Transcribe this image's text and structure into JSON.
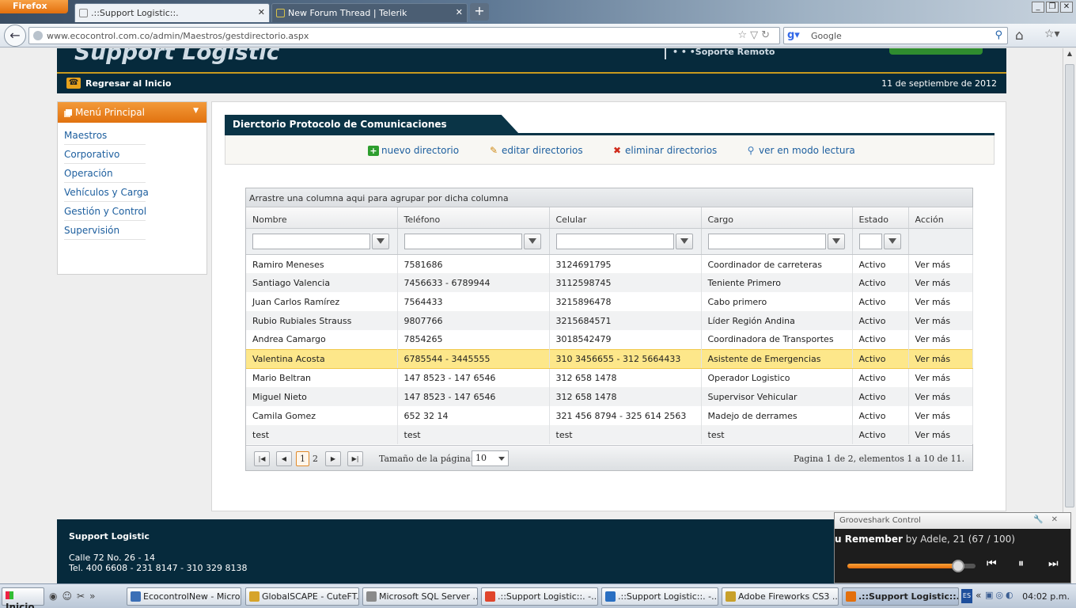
{
  "browser": {
    "menu_label": "Firefox",
    "tabs": [
      {
        "label": ".::Support Logistic::."
      },
      {
        "label": "New Forum Thread | Telerik"
      }
    ],
    "url": "www.ecocontrol.com.co/admin/Maestros/gestdirectorio.aspx",
    "search_placeholder": "Google"
  },
  "site": {
    "logo": "Support Logistic",
    "remote_label": "Soporte Remoto",
    "home_link": "Regresar al Inicio",
    "date": "11 de septiembre de 2012"
  },
  "menu": {
    "title": "Menú Principal",
    "items": [
      {
        "label": "Maestros"
      },
      {
        "label": "Corporativo"
      },
      {
        "label": "Operación"
      },
      {
        "label": "Vehículos y Carga"
      },
      {
        "label": "Gestión y Control"
      },
      {
        "label": "Supervisión"
      }
    ]
  },
  "section": {
    "title": "Dierctorio Protocolo de Comunicaciones",
    "toolbar": {
      "new": "nuevo directorio",
      "edit": "editar directorios",
      "delete": "eliminar directorios",
      "read": "ver en modo lectura"
    }
  },
  "grid": {
    "group_hint": "Arrastre una columna aqui para agrupar por dicha columna",
    "columns": [
      "Nombre",
      "Teléfono",
      "Celular",
      "Cargo",
      "Estado",
      "Acción"
    ],
    "rows": [
      {
        "nombre": "Ramiro Meneses",
        "telefono": "7581686",
        "celular": "3124691795",
        "cargo": "Coordinador de carreteras",
        "estado": "Activo",
        "accion": "Ver más"
      },
      {
        "nombre": "Santiago Valencia",
        "telefono": "7456633 - 6789944",
        "celular": "3112598745",
        "cargo": "Teniente Primero",
        "estado": "Activo",
        "accion": "Ver más"
      },
      {
        "nombre": "Juan Carlos Ramírez",
        "telefono": "7564433",
        "celular": "3215896478",
        "cargo": "Cabo primero",
        "estado": "Activo",
        "accion": "Ver más"
      },
      {
        "nombre": "Rubio Rubiales Strauss",
        "telefono": "9807766",
        "celular": "3215684571",
        "cargo": "Líder Región Andina",
        "estado": "Activo",
        "accion": "Ver más"
      },
      {
        "nombre": "Andrea Camargo",
        "telefono": "7854265",
        "celular": "3018542479",
        "cargo": "Coordinadora de Transportes",
        "estado": "Activo",
        "accion": "Ver más"
      },
      {
        "nombre": "Valentina Acosta",
        "telefono": "6785544 - 3445555",
        "celular": "310 3456655 - 312 5664433",
        "cargo": "Asistente de Emergencias",
        "estado": "Activo",
        "accion": "Ver más"
      },
      {
        "nombre": "Mario Beltran",
        "telefono": "147 8523 - 147 6546",
        "celular": "312 658 1478",
        "cargo": "Operador Logistico",
        "estado": "Activo",
        "accion": "Ver más"
      },
      {
        "nombre": "Miguel Nieto",
        "telefono": "147 8523 - 147 6546",
        "celular": "312 658 1478",
        "cargo": "Supervisor Vehicular",
        "estado": "Activo",
        "accion": "Ver más"
      },
      {
        "nombre": "Camila Gomez",
        "telefono": "652 32 14",
        "celular": "321 456 8794 - 325 614 2563",
        "cargo": "Madejo de derrames",
        "estado": "Activo",
        "accion": "Ver más"
      },
      {
        "nombre": "test",
        "telefono": "test",
        "celular": "test",
        "cargo": "test",
        "estado": "Activo",
        "accion": "Ver más"
      }
    ],
    "pager": {
      "page1": "1",
      "page2": "2",
      "size_label": "Tamaño de la página:",
      "size_value": "10",
      "info": "Pagina 1 de 2, elementos 1 a 10 de 11."
    }
  },
  "footer": {
    "company": "Support Logistic",
    "address": "Calle 72 No. 26 - 14",
    "phones": "Tel. 400 6608 - 231 8147 - 310 329 8138"
  },
  "grooveshark": {
    "title": "Grooveshark Control",
    "song": "u Remember",
    "artist": "by Adele, 21 (67 / 100)",
    "progress": 0.9
  },
  "taskbar": {
    "start": "Inicio",
    "items": [
      {
        "label": "EcocontrolNew - Micro...",
        "color": "#3b6fb6"
      },
      {
        "label": "GlobalSCAPE - CuteFT...",
        "color": "#d6a42a"
      },
      {
        "label": "Microsoft SQL Server ...",
        "color": "#8a8a8a"
      },
      {
        "label": ".::Support Logistic::. -...",
        "color": "#e0452c"
      },
      {
        "label": ".::Support Logistic::. -...",
        "color": "#2a6fc2"
      },
      {
        "label": "Adobe Fireworks CS3 ...",
        "color": "#c8a02a"
      },
      {
        "label": ".::Support Logistic::....",
        "color": "#e36f0c"
      }
    ],
    "lang": "ES",
    "clock": "04:02 p.m."
  }
}
